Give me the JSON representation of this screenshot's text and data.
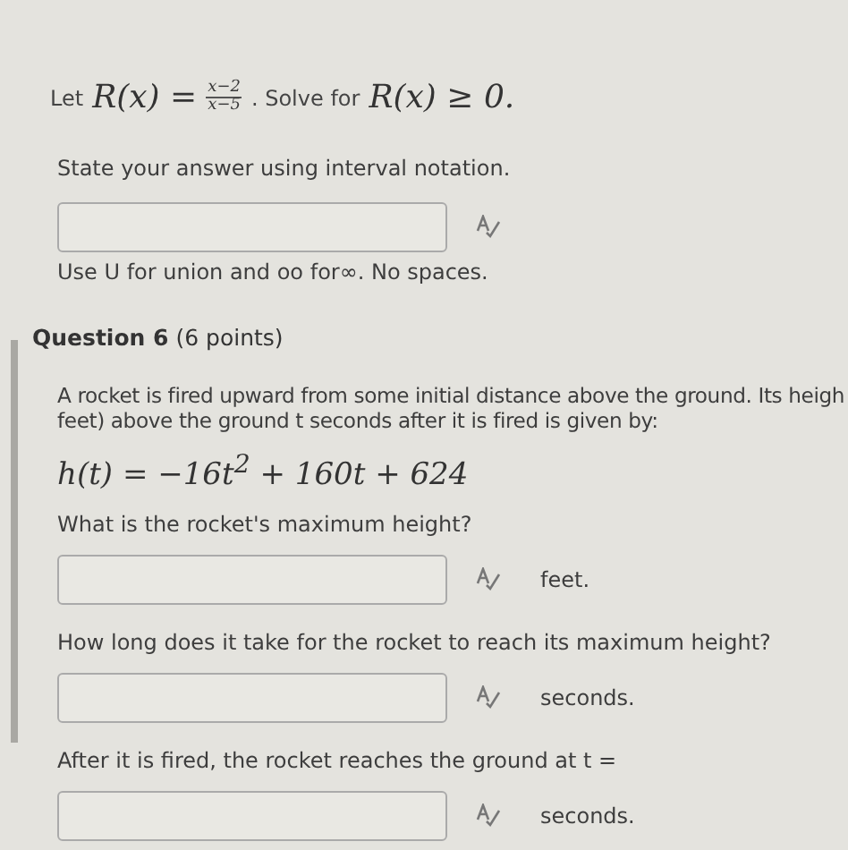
{
  "question_5": {
    "lead": "Let",
    "function": "R(x) =",
    "numerator": "x−2",
    "denominator": "x−5",
    "middle": ". Solve for",
    "condition": "R(x) ≥ 0.",
    "instruction": "State your answer using interval notation.",
    "hint": "Use U for union and oo for∞. No spaces."
  },
  "question_6": {
    "title": "Question 6",
    "points": "(6 points)",
    "prompt_lines": [
      "A rocket is fired upward from some initial distance above the ground. Its heigh",
      "feet) above the ground t seconds after it is fired is given by:"
    ],
    "equation": "h(t) = −16t$^{2}$ + 160t + 624",
    "parts": [
      {
        "question": "What is the rocket's maximum height?",
        "unit": "feet."
      },
      {
        "question": "How long does it take for the rocket to reach its maximum height?",
        "unit": "seconds."
      },
      {
        "question": "After it is fired, the rocket reaches the ground at t =",
        "unit": "seconds."
      }
    ]
  }
}
